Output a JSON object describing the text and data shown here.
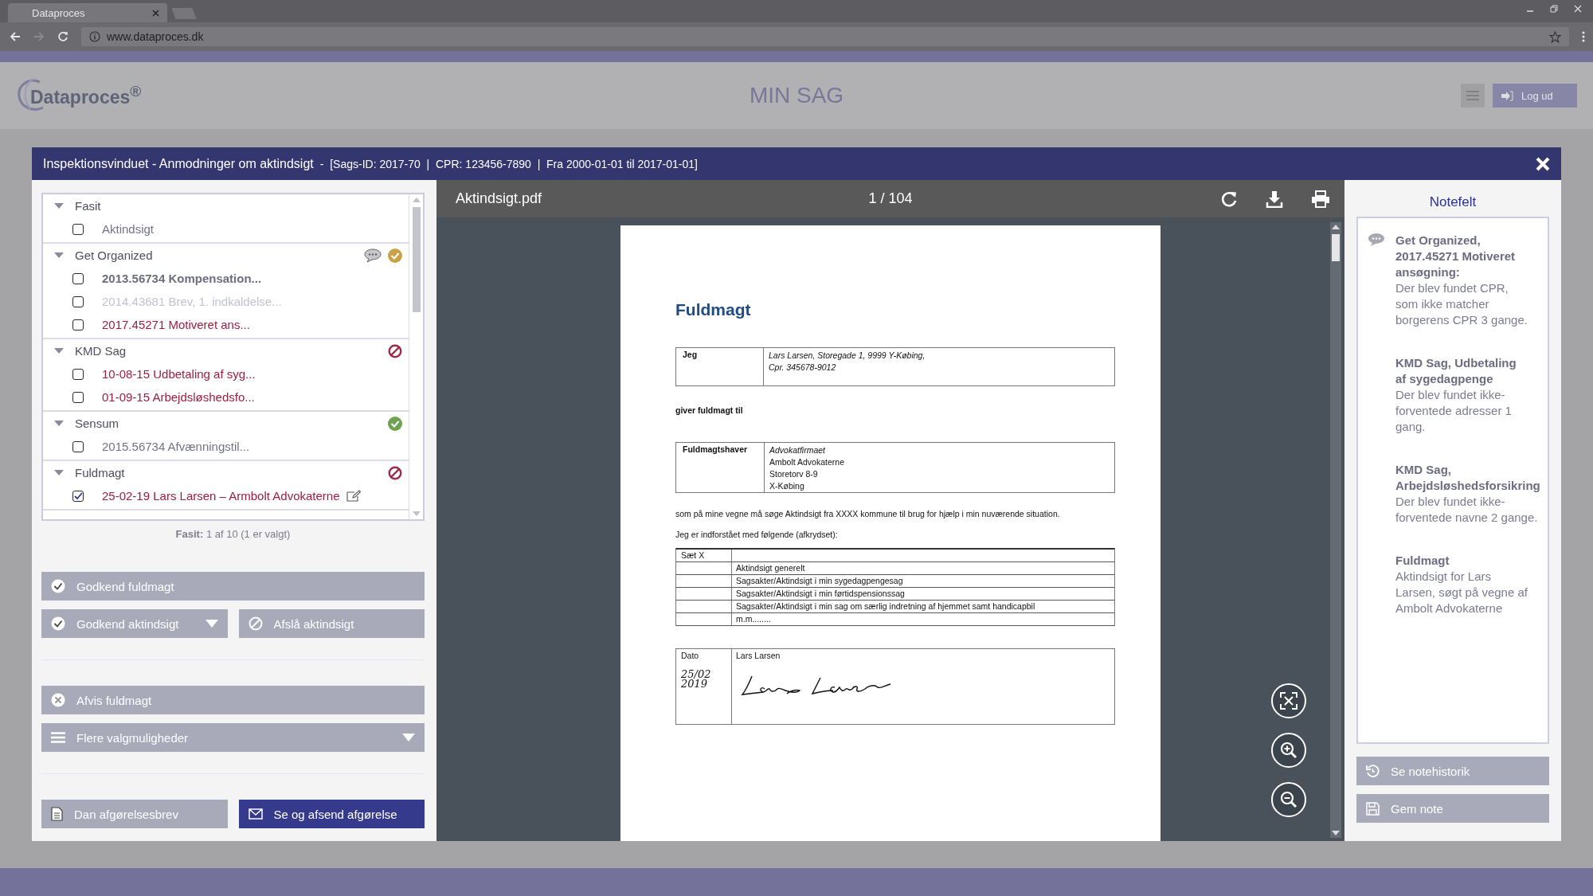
{
  "browser": {
    "tab_title": "Dataproces",
    "url": "www.dataproces.dk"
  },
  "header": {
    "logo": "Dataproces$^{®}$",
    "title": "MIN SAG",
    "logout": "Log ud"
  },
  "modal": {
    "title": "Inspektionsvinduet - Anmodninger om aktindsigt",
    "meta": "-  [Sags-ID: 2017-70  |  CPR: 123456-7890  |  Fra 2000-01-01 til 2017-01-01]"
  },
  "tree": {
    "groups": [
      {
        "name": "Fasit",
        "expanded": true,
        "has_comment": false,
        "kind": "plain",
        "items": [
          {
            "label": "Aktindsigt",
            "kind": "normal",
            "checked": false
          }
        ]
      },
      {
        "name": "Get Organized",
        "expanded": true,
        "has_comment": true,
        "kind": "pending",
        "items": [
          {
            "label": "2013.56734 Kompensation...",
            "kind": "bold",
            "checked": false
          },
          {
            "label": "2014.43681 Brev, 1. indkaldelse...",
            "kind": "faded",
            "checked": false
          },
          {
            "label": "2017.45271 Motiveret ans...",
            "kind": "flagged",
            "checked": false
          }
        ]
      },
      {
        "name": "KMD Sag",
        "expanded": true,
        "has_comment": false,
        "kind": "rejected",
        "items": [
          {
            "label": "10-08-15 Udbetaling af syg...",
            "kind": "flagged",
            "checked": false
          },
          {
            "label": "01-09-15 Arbejdsløshedsfo...",
            "kind": "flagged",
            "checked": false
          }
        ]
      },
      {
        "name": "Sensum",
        "expanded": true,
        "has_comment": false,
        "kind": "approved",
        "items": [
          {
            "label": "2015.56734 Afvænningstil...",
            "kind": "normal",
            "checked": false
          }
        ]
      },
      {
        "name": "Fuldmagt",
        "expanded": true,
        "has_comment": false,
        "kind": "rejected",
        "items": [
          {
            "label": "25-02-19 Lars Larsen – Armbolt Advokaterne",
            "kind": "flagged",
            "checked": true,
            "editable": true
          }
        ]
      }
    ],
    "summary": "**Fasit:** 1 af 10 (1 er valgt)"
  },
  "action_groups": [
    {
      "rows": [
        [
          {
            "label": "Godkend fuldmagt",
            "kind": "check"
          }
        ],
        [
          {
            "label": "Godkend aktindsigt",
            "kind": "check",
            "caret": true
          },
          {
            "label": "Afslå aktindsigt",
            "kind": "forbid"
          }
        ]
      ]
    },
    {
      "rows": [
        [
          {
            "label": "Afvis fuldmagt",
            "kind": "cross"
          }
        ],
        [
          {
            "label": "Flere valgmuligheder",
            "kind": "menu",
            "caret": true
          }
        ]
      ]
    },
    {
      "rows": [
        [
          {
            "label": "Dan afgørelsesbrev",
            "kind": "document"
          },
          {
            "label": "Se og afsend afgørelse",
            "kind": "envelope",
            "primary": true
          }
        ]
      ]
    }
  ],
  "viewer": {
    "filename": "Aktindsigt.pdf",
    "page": "1 / 104"
  },
  "document": {
    "title": "Fuldmagt",
    "grantor": {
      "label": "Jeg",
      "lines": [
        {
          "text": "Lars Larsen, Storegade 1, 9999 Y-Købing,",
          "italic": true
        },
        {
          "text": "Cpr. 345678-9012",
          "italic": true
        }
      ]
    },
    "grant_text": "giver fuldmagt til",
    "attorney": {
      "label": "Fuldmagtshaver",
      "lines": [
        {
          "text": "Advokatfirmaet",
          "italic": true
        },
        {
          "text": "Ambolt Advokaterne",
          "italic": false
        },
        {
          "text": "Storetorv 8-9",
          "italic": false
        },
        {
          "text": "X-Købing",
          "italic": false
        }
      ]
    },
    "paragraphs": [
      "som på mine vegne må søge Aktindsigt fra XXXX kommune til brug for hjælp i min nuværende situation.",
      "Jeg er indforstået med følgende (afkrydset):"
    ],
    "checklist": {
      "header": "Sæt X",
      "rows": [
        "Aktindsigt generelt",
        "Sagsakter/Aktindsigt i min sygedagpengesag",
        "Sagsakter/Aktindsigt i min førtidspensionssag",
        "Sagsakter/Aktindsigt i min sag om særlig indretning af hjemmet samt handicapbil",
        "m.m........"
      ]
    },
    "signature": {
      "date_label": "Dato",
      "name": "Lars Larsen",
      "handwritten_date": [
        "25/02",
        "2019"
      ]
    }
  },
  "notes": {
    "title": "Notefelt",
    "entries": [
      {
        "heading": "Get Organized, 2017.45271 Motiveret ansøgning:",
        "body": "Der blev fundet CPR, som ikke matcher borgerens CPR 3 gange.",
        "comment": true
      },
      {
        "heading": "KMD Sag, Udbetaling af sygedagpenge",
        "body": "Der blev fundet ikke-forventede adresser 1 gang.",
        "comment": false
      },
      {
        "heading": "KMD Sag, Arbejdsløshedsforsikring",
        "body": "Der blev fundet ikke-forventede navne 2 gange.",
        "comment": false
      },
      {
        "heading": "Fuldmagt",
        "body": "Aktindsigt for Lars Larsen, søgt på vegne af Ambolt Advokaterne",
        "comment": false
      }
    ],
    "buttons": [
      {
        "label": "Se notehistorik",
        "kind": "history"
      },
      {
        "label": "Gem note",
        "kind": "save"
      }
    ]
  }
}
